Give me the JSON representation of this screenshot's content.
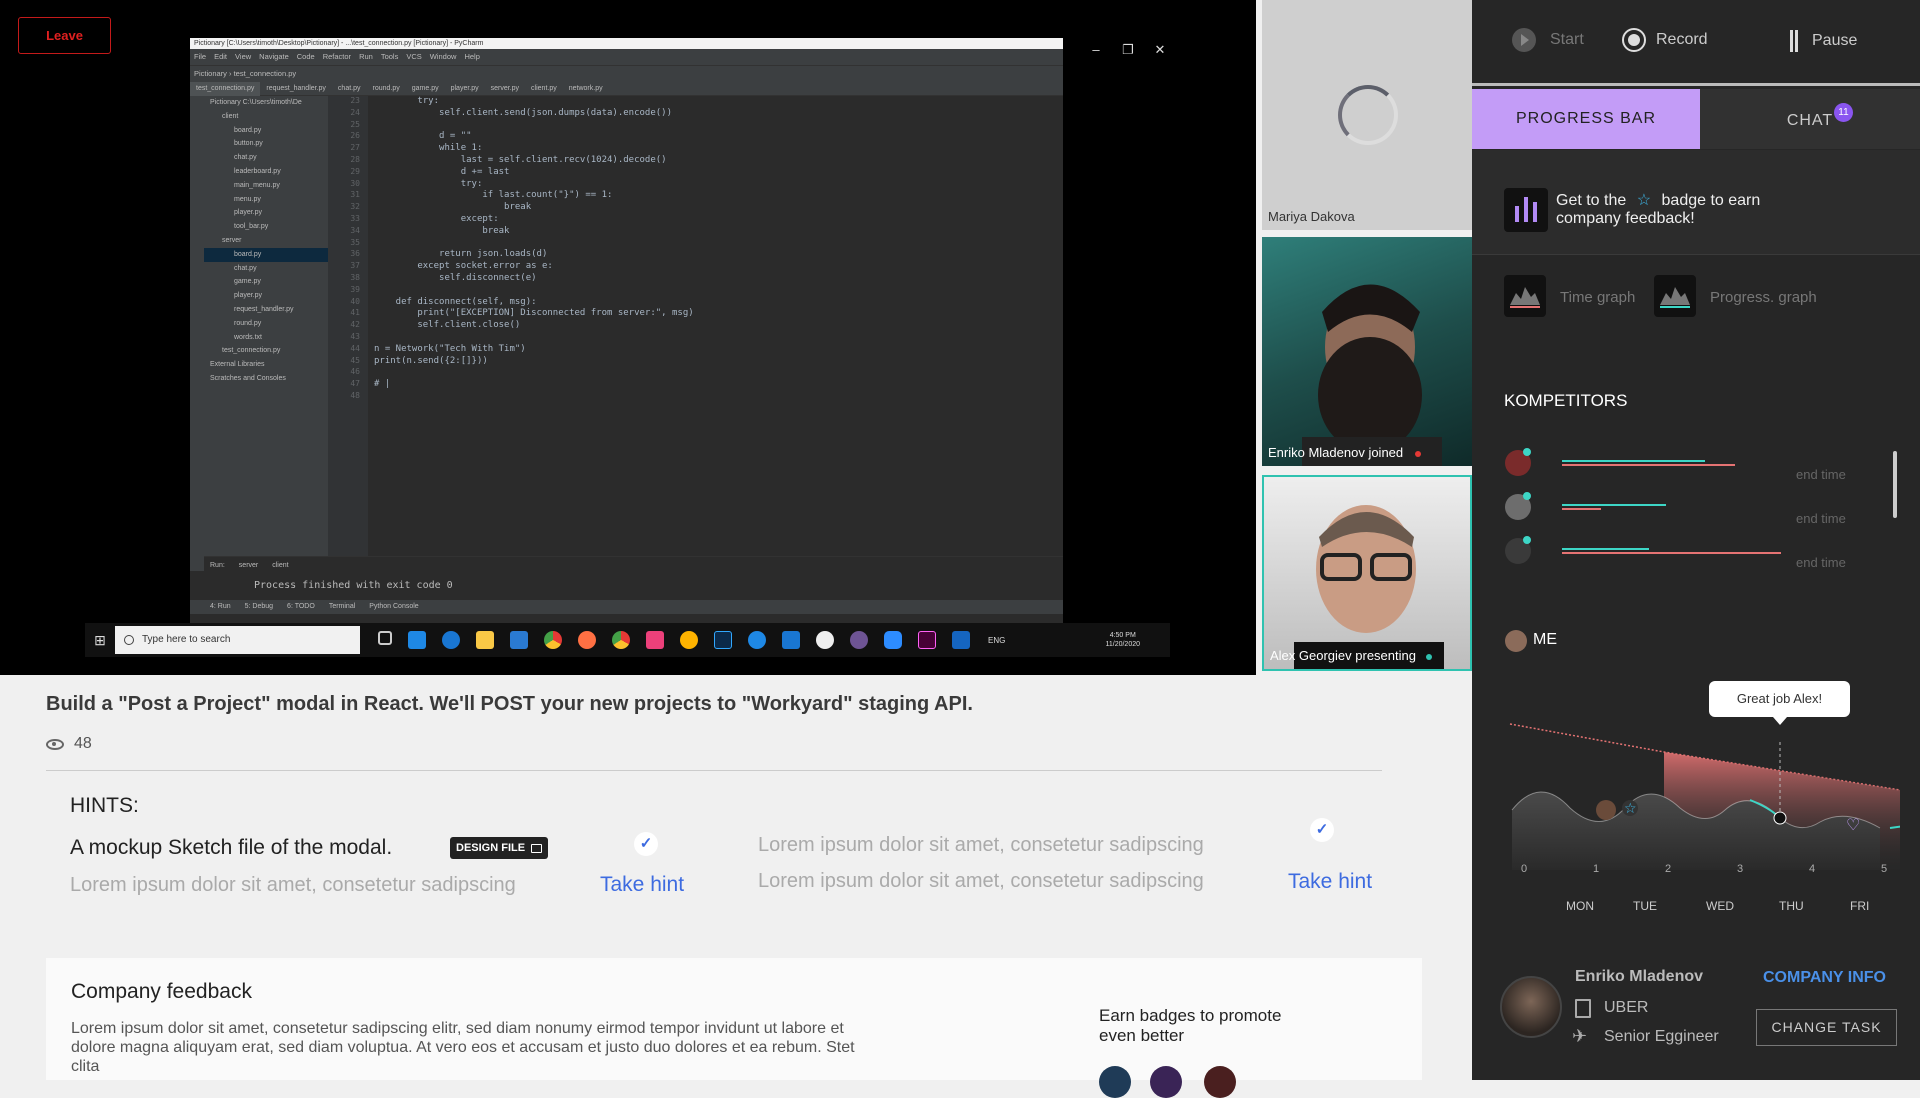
{
  "screen_share": {
    "leave_label": "Leave",
    "ide": {
      "window_title": "Pictionary [C:\\Users\\timoth\\Desktop\\Pictionary] - ...\\test_connection.py [Pictionary] - PyCharm",
      "menu": [
        "File",
        "Edit",
        "View",
        "Navigate",
        "Code",
        "Refactor",
        "Run",
        "Tools",
        "VCS",
        "Window",
        "Help"
      ],
      "breadcrumb": "Pictionary  ›  test_connection.py",
      "tabs": [
        "test_connection.py",
        "request_handler.py",
        "chat.py",
        "round.py",
        "game.py",
        "player.py",
        "server.py",
        "client.py",
        "network.py"
      ],
      "active_tab": "test_connection.py",
      "tree": [
        {
          "label": "Pictionary  C:\\Users\\timoth\\De",
          "depth": 0
        },
        {
          "label": "client",
          "depth": 1
        },
        {
          "label": "board.py",
          "depth": 2
        },
        {
          "label": "button.py",
          "depth": 2
        },
        {
          "label": "chat.py",
          "depth": 2
        },
        {
          "label": "leaderboard.py",
          "depth": 2
        },
        {
          "label": "main_menu.py",
          "depth": 2
        },
        {
          "label": "menu.py",
          "depth": 2
        },
        {
          "label": "player.py",
          "depth": 2
        },
        {
          "label": "tool_bar.py",
          "depth": 2
        },
        {
          "label": "server",
          "depth": 1
        },
        {
          "label": "board.py",
          "depth": 2,
          "selected": true
        },
        {
          "label": "chat.py",
          "depth": 2
        },
        {
          "label": "game.py",
          "depth": 2
        },
        {
          "label": "player.py",
          "depth": 2
        },
        {
          "label": "request_handler.py",
          "depth": 2
        },
        {
          "label": "round.py",
          "depth": 2
        },
        {
          "label": "words.txt",
          "depth": 2
        },
        {
          "label": "test_connection.py",
          "depth": 1
        },
        {
          "label": "External Libraries",
          "depth": 0
        },
        {
          "label": "Scratches and Consoles",
          "depth": 0
        }
      ],
      "code_lines": [
        {
          "n": "23",
          "text": "        try:"
        },
        {
          "n": "24",
          "text": "            self.client.send(json.dumps(data).encode())"
        },
        {
          "n": "25",
          "text": ""
        },
        {
          "n": "26",
          "text": "            d = \"\""
        },
        {
          "n": "27",
          "text": "            while 1:"
        },
        {
          "n": "28",
          "text": "                last = self.client.recv(1024).decode()"
        },
        {
          "n": "29",
          "text": "                d += last"
        },
        {
          "n": "30",
          "text": "                try:"
        },
        {
          "n": "31",
          "text": "                    if last.count(\"}\") == 1:"
        },
        {
          "n": "32",
          "text": "                        break"
        },
        {
          "n": "33",
          "text": "                except:"
        },
        {
          "n": "34",
          "text": "                    break"
        },
        {
          "n": "35",
          "text": ""
        },
        {
          "n": "36",
          "text": "            return json.loads(d)"
        },
        {
          "n": "37",
          "text": "        except socket.error as e:"
        },
        {
          "n": "38",
          "text": "            self.disconnect(e)"
        },
        {
          "n": "39",
          "text": ""
        },
        {
          "n": "40",
          "text": "    def disconnect(self, msg):"
        },
        {
          "n": "41",
          "text": "        print(\"[EXCEPTION] Disconnected from server:\", msg)"
        },
        {
          "n": "42",
          "text": "        self.client.close()"
        },
        {
          "n": "43",
          "text": ""
        },
        {
          "n": "44",
          "text": "n = Network(\"Tech With Tim\")"
        },
        {
          "n": "45",
          "text": "print(n.send({2:[]}))"
        },
        {
          "n": "46",
          "text": ""
        },
        {
          "n": "47",
          "text": "# |"
        },
        {
          "n": "48",
          "text": ""
        }
      ],
      "run_tabs": [
        "Run:",
        "server",
        "client"
      ],
      "run_output": "Process finished with exit code 0",
      "bottom_tools": [
        "4: Run",
        "5: Debug",
        "6: TODO",
        "Terminal",
        "Python Console"
      ]
    },
    "window_controls": [
      "–",
      "❐",
      "✕"
    ],
    "taskbar": {
      "search_placeholder": "Type here to search",
      "language": "ENG",
      "time": "4:50 PM",
      "date": "11/20/2020"
    }
  },
  "participants": [
    {
      "name": "Mariya Dakova",
      "status": "loading"
    },
    {
      "name": "Enriko Mladenov joined",
      "status_color": "#e53935"
    },
    {
      "name": "Alex Georgiev presenting",
      "status_color": "#2fc2b0"
    }
  ],
  "task": {
    "title": "Build a \"Post a Project\" modal in React. We'll POST your new projects to \"Workyard\" staging API.",
    "views": "48",
    "hints_label": "HINTS:",
    "hint1": "A mockup Sketch file of the modal.",
    "design_file_label": "DESIGN FILE",
    "hint_lorem": "Lorem ipsum dolor sit amet, consetetur sadipscing",
    "take_hint_label": "Take hint",
    "feedback_title": "Company feedback",
    "feedback_body": "Lorem ipsum dolor sit amet, consetetur sadipscing elitr, sed diam nonumy eirmod tempor invidunt ut labore et dolore magna aliquyam erat, sed diam voluptua. At vero eos et accusam et justo duo dolores et ea rebum. Stet clita",
    "earn_badges": "Earn badges to promote even better"
  },
  "sidebar": {
    "controls": {
      "start": "Start",
      "record": "Record",
      "pause": "Pause"
    },
    "tabs": {
      "progress": "PROGRESS BAR",
      "chat": "CHAT",
      "chat_count": "11"
    },
    "goal_text_before": "Get to the",
    "goal_text_after": "badge to earn company feedback!",
    "time_graph": "Time graph",
    "progress_graph": "Progress. graph",
    "competitors_title": "KOMPETITORS",
    "competitors": [
      {
        "end_label": "end time",
        "teal": 0.62,
        "red": 0.75
      },
      {
        "end_label": "end time",
        "teal": 0.45,
        "red": 0.17
      },
      {
        "end_label": "end time",
        "teal": 0.38,
        "red": 0.95
      }
    ],
    "me_label": "ME",
    "speech": "Great job Alex!",
    "x_ticks": [
      "0",
      "1",
      "2",
      "3",
      "4",
      "5"
    ],
    "days": [
      "MON",
      "TUE",
      "WED",
      "THU",
      "FRI"
    ],
    "user": {
      "name": "Enriko Mladenov",
      "company": "UBER",
      "role": "Senior Eggineer",
      "company_info": "COMPANY INFO",
      "change_task": "CHANGE TASK"
    },
    "accent_purple": "#c39cf7",
    "accent_teal": "#3dd6c6",
    "accent_red": "#e57373"
  }
}
